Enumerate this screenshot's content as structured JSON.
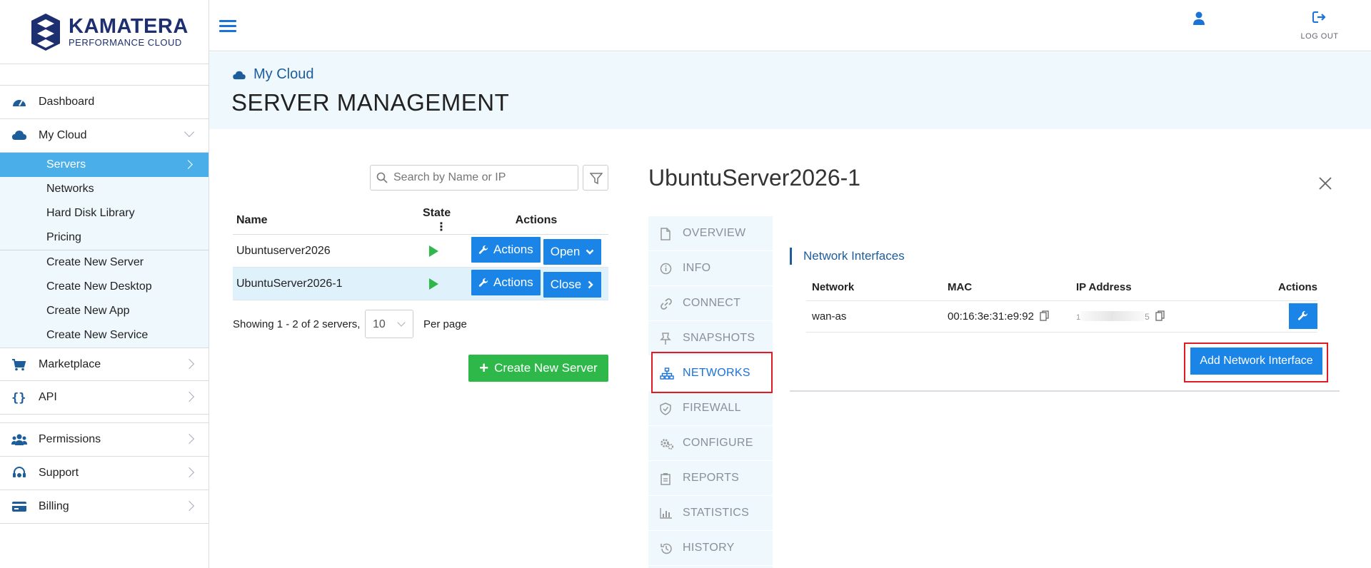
{
  "brand": {
    "name": "KAMATERA",
    "tagline": "PERFORMANCE CLOUD"
  },
  "topbar": {
    "logout_label": "LOG OUT"
  },
  "sidebar": {
    "items": [
      {
        "label": "Dashboard",
        "icon": "dashboard-icon"
      },
      {
        "label": "My Cloud",
        "icon": "cloud-icon"
      }
    ],
    "mycloud_sub": [
      "Servers",
      "Networks",
      "Hard Disk Library",
      "Pricing"
    ],
    "mycloud_create": [
      "Create New Server",
      "Create New Desktop",
      "Create New App",
      "Create New Service"
    ],
    "items_after": [
      {
        "label": "Marketplace",
        "icon": "cart-icon"
      },
      {
        "label": "API",
        "icon": "braces-icon"
      }
    ],
    "items_bottom": [
      {
        "label": "Permissions",
        "icon": "users-icon"
      },
      {
        "label": "Support",
        "icon": "headset-icon"
      },
      {
        "label": "Billing",
        "icon": "card-icon"
      }
    ]
  },
  "header": {
    "breadcrumb": "My Cloud",
    "title": "SERVER MANAGEMENT"
  },
  "list": {
    "search_placeholder": "Search by Name or IP",
    "columns": {
      "name": "Name",
      "state": "State",
      "actions": "Actions"
    },
    "rows": [
      {
        "name": "Ubuntuserver2026",
        "state": "running",
        "actions_label": "Actions",
        "toggle_label": "Open"
      },
      {
        "name": "UbuntuServer2026-1",
        "state": "running",
        "actions_label": "Actions",
        "toggle_label": "Close"
      }
    ],
    "showing": "Showing 1 - 2 of 2 servers,",
    "per_page_value": "10",
    "per_page_label": "Per page",
    "create_button": "Create New Server"
  },
  "detail": {
    "server_name": "UbuntuServer2026-1",
    "tabs": [
      "OVERVIEW",
      "INFO",
      "CONNECT",
      "SNAPSHOTS",
      "NETWORKS",
      "FIREWALL",
      "CONFIGURE",
      "REPORTS",
      "STATISTICS",
      "HISTORY"
    ],
    "active_tab": "NETWORKS",
    "section_title": "Network Interfaces",
    "columns": {
      "network": "Network",
      "mac": "MAC",
      "ip": "IP Address",
      "actions": "Actions"
    },
    "interfaces": [
      {
        "network": "wan-as",
        "mac": "00:16:3e:31:e9:92",
        "ip_head": "1",
        "ip_tail": "5"
      }
    ],
    "add_button": "Add Network Interface"
  },
  "colors": {
    "primary": "#1a85e6",
    "success": "#2eb84a",
    "highlight": "#e01b24",
    "sidebar_active": "#4aaee8"
  }
}
